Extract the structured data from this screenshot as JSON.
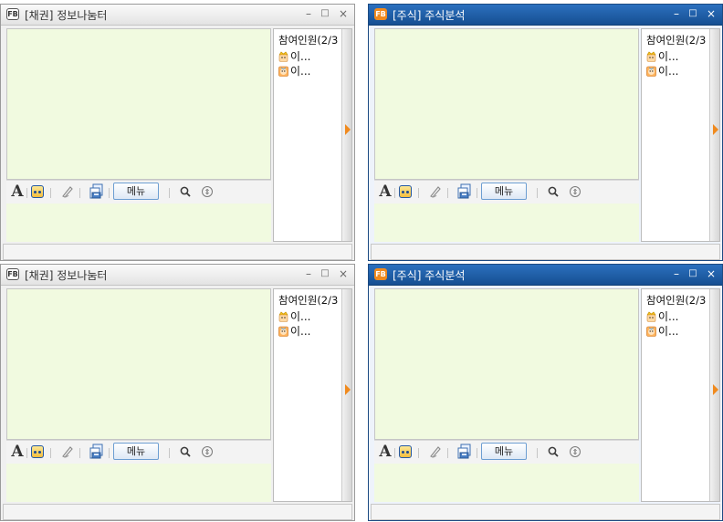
{
  "windows": [
    {
      "title": "[채권] 정보나눔터",
      "logo": "FB",
      "controls": {
        "minimize": "–",
        "maximize": "□",
        "close": "×"
      },
      "toolbar": {
        "font_icon": "A",
        "menu_label": "메뉴"
      },
      "participants": {
        "header": "참여인원(2/3",
        "users": [
          "이...",
          "이..."
        ]
      }
    },
    {
      "title": "[주식] 주식분석",
      "logo": "FB",
      "controls": {
        "minimize": "–",
        "maximize": "□",
        "close": "×"
      },
      "toolbar": {
        "font_icon": "A",
        "menu_label": "메뉴"
      },
      "participants": {
        "header": "참여인원(2/3",
        "users": [
          "이...",
          "이..."
        ]
      }
    },
    {
      "title": "[채권] 정보나눔터",
      "logo": "FB",
      "controls": {
        "minimize": "–",
        "maximize": "□",
        "close": "×"
      },
      "toolbar": {
        "font_icon": "A",
        "menu_label": "메뉴"
      },
      "participants": {
        "header": "참여인원(2/3",
        "users": [
          "이...",
          "이..."
        ]
      }
    },
    {
      "title": "[주식] 주식분석",
      "logo": "FB",
      "controls": {
        "minimize": "–",
        "maximize": "□",
        "close": "×"
      },
      "toolbar": {
        "font_icon": "A",
        "menu_label": "메뉴"
      },
      "participants": {
        "header": "참여인원(2/3",
        "users": [
          "이...",
          "이..."
        ]
      }
    }
  ],
  "colors": {
    "active_titlebar": "#1f5fa8",
    "inactive_titlebar": "#e8e8e8",
    "chat_background": "#f1fae0",
    "accent_orange": "#f08a1e"
  },
  "icons": [
    "fb-logo-icon",
    "font-icon",
    "emoticon-icon",
    "pen-icon",
    "file-transfer-icon",
    "search-icon",
    "more-icon",
    "crown-avatar-icon",
    "face-avatar-icon",
    "scroll-arrow-icon"
  ]
}
